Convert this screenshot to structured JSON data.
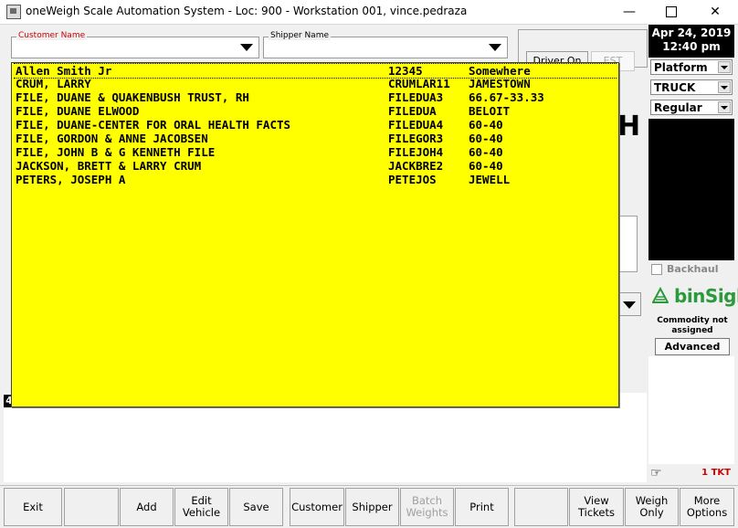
{
  "window": {
    "title": "oneWeigh Scale Automation System - Loc: 900 - Workstation 001, vince.pedraza",
    "minimize_glyph": "—",
    "close_glyph": "✕"
  },
  "form": {
    "customer_label": "Customer Name",
    "shipper_label": "Shipper Name",
    "driver_on_label": "Driver On",
    "est_label": "EST"
  },
  "popup": {
    "rows": [
      {
        "name": "Allen Smith Jr",
        "code": "12345",
        "location": "Somewhere"
      },
      {
        "name": "CRUM, LARRY",
        "code": "CRUMLAR11",
        "location": "JAMESTOWN"
      },
      {
        "name": "FILE, DUANE & QUAKENBUSH TRUST, RH",
        "code": "FILEDUA3",
        "location": "66.67-33.33"
      },
      {
        "name": "FILE, DUANE ELWOOD",
        "code": "FILEDUA",
        "location": "BELOIT"
      },
      {
        "name": "FILE, DUANE-CENTER FOR ORAL HEALTH FACTS",
        "code": "FILEDUA4",
        "location": "60-40"
      },
      {
        "name": "FILE, GORDON & ANNE JACOBSEN",
        "code": "FILEGOR3",
        "location": "60-40"
      },
      {
        "name": "FILE, JOHN B & G KENNETH FILE",
        "code": "FILEJOH4",
        "location": "60-40"
      },
      {
        "name": "JACKSON, BRETT & LARRY CRUM",
        "code": "JACKBRE2",
        "location": "60-40"
      },
      {
        "name": "PETERS, JOSEPH A",
        "code": "PETEJOS",
        "location": "JEWELL"
      }
    ]
  },
  "sidebar": {
    "date": "Apr 24, 2019",
    "time": "12:40 pm",
    "scale_select": "Platform",
    "vehicle_select": "TRUCK",
    "type_select": "Regular",
    "backhaul_label": "Backhaul",
    "binsight_label": "binSight",
    "commodity_status": "Commodity not assigned",
    "advanced_button": "Advanced",
    "ticket_count": "1 TKT"
  },
  "main": {
    "partial_letter": "H",
    "ticket_number_fragment": "4"
  },
  "toolbar": {
    "exit": "Exit",
    "add": "Add",
    "edit_vehicle_1": "Edit",
    "edit_vehicle_2": "Vehicle",
    "save": "Save",
    "customer": "Customer",
    "shipper": "Shipper",
    "batch_weights_1": "Batch",
    "batch_weights_2": "Weights",
    "print": "Print",
    "view_tickets_1": "View",
    "view_tickets_2": "Tickets",
    "weigh_only_1": "Weigh",
    "weigh_only_2": "Only",
    "more_options_1": "More",
    "more_options_2": "Options"
  },
  "colors": {
    "popup_background": "#ffff00",
    "customer_label_color": "#cc0000",
    "binsight_green": "#2a9a3a",
    "ticket_count_red": "#cc0000"
  }
}
